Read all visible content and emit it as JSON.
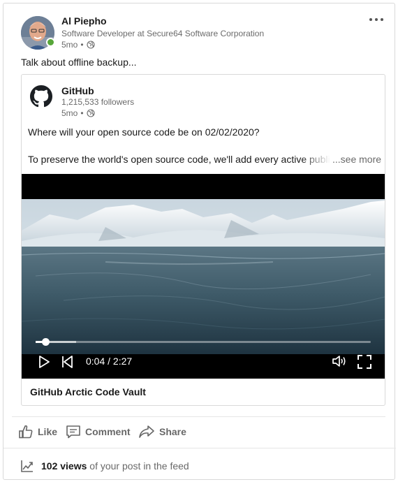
{
  "author": {
    "name": "Al Piepho",
    "headline": "Software Developer at Secure64 Software Corporation",
    "time": "5mo"
  },
  "post": {
    "text": "Talk about offline backup..."
  },
  "shared": {
    "org_name": "GitHub",
    "followers": "1,215,533 followers",
    "time": "5mo",
    "question": "Where will your open source code be on 02/02/2020?",
    "body": "To preserve the world's open source code, we'll add every active public",
    "see_more": "...see more"
  },
  "video": {
    "current_time": "0:04",
    "separator": "/",
    "duration": "2:27",
    "played_fraction": 0.03,
    "buffered_fraction": 0.12,
    "title": "GitHub Arctic Code Vault"
  },
  "actions": {
    "like": "Like",
    "comment": "Comment",
    "share": "Share"
  },
  "stats": {
    "views": "102 views",
    "views_suffix": "of your post in the feed"
  },
  "icons": {
    "more": "ellipsis-icon",
    "visibility": "globe-icon",
    "org_logo": "github-octocat-icon",
    "play": "play-icon",
    "restart": "skip-back-icon",
    "volume": "volume-icon",
    "fullscreen": "fullscreen-icon",
    "like": "thumbs-up-icon",
    "comment": "comment-icon",
    "share": "share-arrow-icon",
    "analytics": "trend-chart-icon"
  },
  "colors": {
    "presence": "#57a639",
    "video_bg": "#000000"
  }
}
